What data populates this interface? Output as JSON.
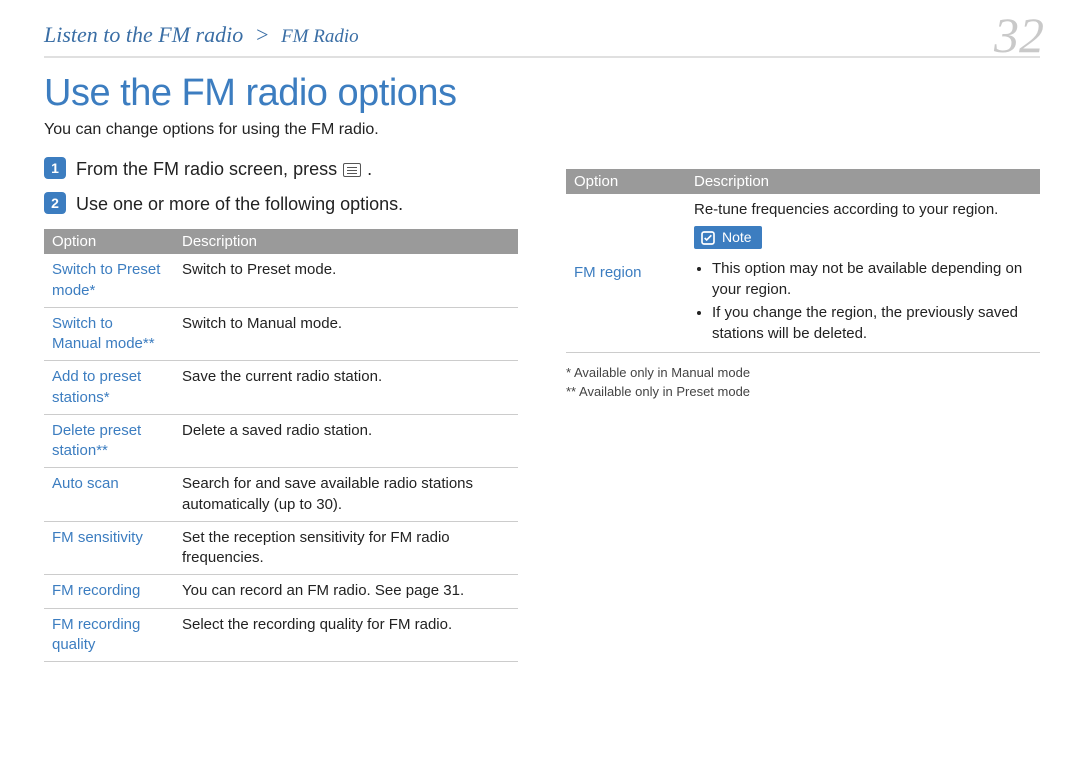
{
  "breadcrumb": {
    "main": "Listen to the FM radio",
    "sep": ">",
    "tail": "FM Radio"
  },
  "page_number": "32",
  "title": "Use the FM radio options",
  "intro": "You can change options for using the FM radio.",
  "steps": [
    {
      "num": "1",
      "text_pre": "From the FM radio screen, press",
      "text_post": "."
    },
    {
      "num": "2",
      "text": "Use one or more of the following options."
    }
  ],
  "table_headers": {
    "option": "Option",
    "description": "Description"
  },
  "left_rows": [
    {
      "option": "Switch to Preset mode*",
      "desc": "Switch to Preset mode."
    },
    {
      "option": "Switch to Manual mode**",
      "desc": "Switch to Manual mode."
    },
    {
      "option": "Add to preset stations*",
      "desc": "Save the current radio station."
    },
    {
      "option": "Delete preset station**",
      "desc": "Delete a saved radio station."
    },
    {
      "option": "Auto scan",
      "desc": "Search for and save available radio stations automatically (up to 30)."
    },
    {
      "option": "FM sensitivity",
      "desc": "Set the reception sensitivity for FM radio frequencies."
    },
    {
      "option": "FM recording",
      "desc": "You can record an FM radio. See page 31."
    },
    {
      "option": "FM recording quality",
      "desc": "Select the recording quality for FM radio."
    }
  ],
  "right_row": {
    "option": "FM region",
    "desc_main": "Re-tune frequencies according to your region.",
    "note_label": "Note",
    "notes": [
      "This option may not be available depending on your region.",
      "If you change the region, the previously saved stations will be deleted."
    ]
  },
  "footnotes": {
    "a": "* Available only in Manual mode",
    "b": "** Available only in Preset mode"
  }
}
